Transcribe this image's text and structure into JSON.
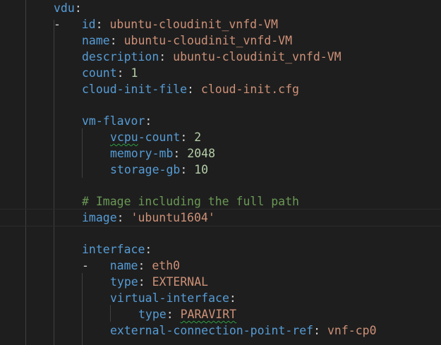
{
  "lines": {
    "vdu_key": "vdu",
    "colon": ":",
    "dash": "-",
    "id_key": "id",
    "id_val": "ubuntu-cloudinit_vnfd-VM",
    "name_key": "name",
    "name_val": "ubuntu-cloudinit_vnfd-VM",
    "desc_key": "description",
    "desc_val": "ubuntu-cloudinit_vnfd-VM",
    "count_key": "count",
    "count_val": "1",
    "cloudinit_key": "cloud-init-file",
    "cloudinit_val": "cloud-init.cfg",
    "vmflavor_key": "vm-flavor",
    "vcpu_key_a": "vcpu",
    "vcpu_key_b": "-count",
    "vcpu_val": "2",
    "memory_key": "memory-mb",
    "memory_val": "2048",
    "storage_key": "storage-gb",
    "storage_val": "10",
    "comment": "# Image including the full path",
    "image_key": "image",
    "image_val": "'ubuntu1604'",
    "interface_key": "interface",
    "ifname_key": "name",
    "ifname_val": "eth0",
    "type_key": "type",
    "type_val": "EXTERNAL",
    "vif_key": "virtual-interface",
    "vif_type_key": "type",
    "vif_type_val": "PARAVIRT",
    "ecp_key": "external-connection-point-ref",
    "ecp_val": "vnf-cp0"
  },
  "colors": {
    "background": "#1e1e1e",
    "key": "#569cd6",
    "string": "#ce9178",
    "number": "#b5cea8",
    "comment": "#6a9955",
    "squiggle": "#2ea043"
  }
}
